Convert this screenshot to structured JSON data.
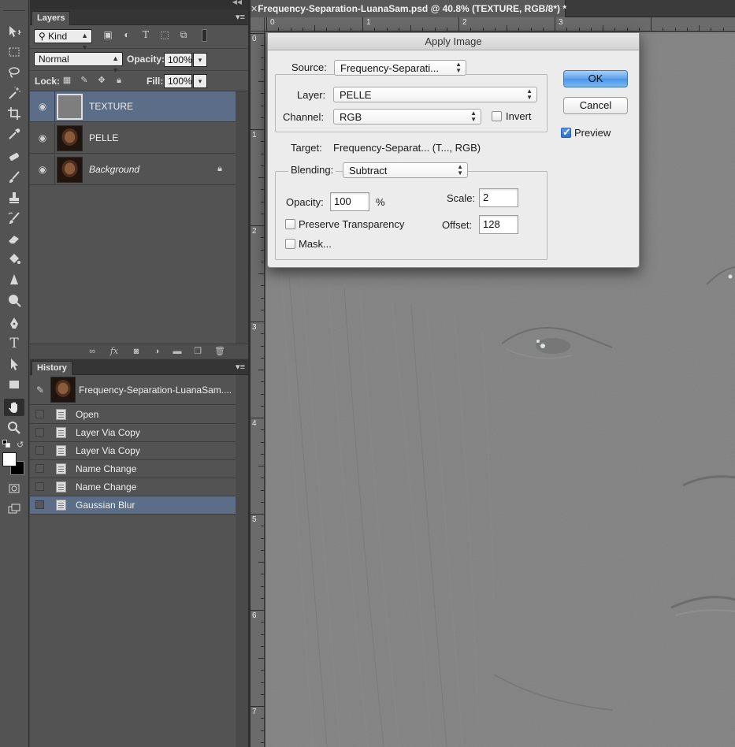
{
  "layers_panel": {
    "tab": "Layers",
    "filter_kind": "Kind",
    "blend_mode": "Normal",
    "opacity_label": "Opacity:",
    "opacity_value": "100%",
    "lock_label": "Lock:",
    "fill_label": "Fill:",
    "fill_value": "100%",
    "layers": [
      {
        "name": "TEXTURE",
        "selected": true,
        "thumb": "gray"
      },
      {
        "name": "PELLE",
        "selected": false,
        "thumb": "face"
      },
      {
        "name": "Background",
        "selected": false,
        "thumb": "face",
        "locked": true
      }
    ],
    "footer_icons": [
      "link-icon",
      "fx-icon",
      "mask-icon",
      "adjustment-icon",
      "folder-icon",
      "new-layer-icon",
      "trash-icon"
    ]
  },
  "history_panel": {
    "tab": "History",
    "snapshot_name": "Frequency-Separation-LuanaSam....",
    "steps": [
      {
        "name": "Open",
        "selected": false
      },
      {
        "name": "Layer Via Copy",
        "selected": false
      },
      {
        "name": "Layer Via Copy",
        "selected": false
      },
      {
        "name": "Name Change",
        "selected": false
      },
      {
        "name": "Name Change",
        "selected": false
      },
      {
        "name": "Gaussian Blur",
        "selected": true
      }
    ]
  },
  "document": {
    "tab_title": "Frequency-Separation-LuanaSam.psd @ 40.8% (TEXTURE, RGB/8*) *",
    "ruler_h": [
      "0",
      "1",
      "2",
      "3"
    ],
    "ruler_v": [
      "0",
      "1",
      "2",
      "3",
      "4",
      "5",
      "6",
      "7"
    ]
  },
  "apply_image_dialog": {
    "title": "Apply Image",
    "source_label": "Source:",
    "source_value": "Frequency-Separati...",
    "layer_label": "Layer:",
    "layer_value": "PELLE",
    "channel_label": "Channel:",
    "channel_value": "RGB",
    "invert_label": "Invert",
    "invert_checked": false,
    "target_label": "Target:",
    "target_value": "Frequency-Separat... (T..., RGB)",
    "blending_label": "Blending:",
    "blending_value": "Subtract",
    "opacity_label": "Opacity:",
    "opacity_value": "100",
    "percent": "%",
    "scale_label": "Scale:",
    "scale_value": "2",
    "offset_label": "Offset:",
    "offset_value": "128",
    "preserve_label": "Preserve Transparency",
    "preserve_checked": false,
    "mask_label": "Mask...",
    "mask_checked": false,
    "ok_label": "OK",
    "cancel_label": "Cancel",
    "preview_label": "Preview",
    "preview_checked": true
  },
  "toolbar": {
    "tools": [
      "move-icon",
      "marquee-icon",
      "lasso-icon",
      "magic-wand-icon",
      "crop-icon",
      "eyedropper-icon",
      "healing-brush-icon",
      "brush-icon",
      "clone-stamp-icon",
      "history-brush-icon",
      "eraser-icon",
      "paint-bucket-icon",
      "blur-icon",
      "dodge-icon",
      "pen-icon",
      "type-icon",
      "path-selection-icon",
      "rectangle-icon",
      "hand-icon",
      "zoom-icon"
    ],
    "active_tool": "hand-icon",
    "foreground_color": "#ffffff",
    "background_color": "#000000"
  }
}
